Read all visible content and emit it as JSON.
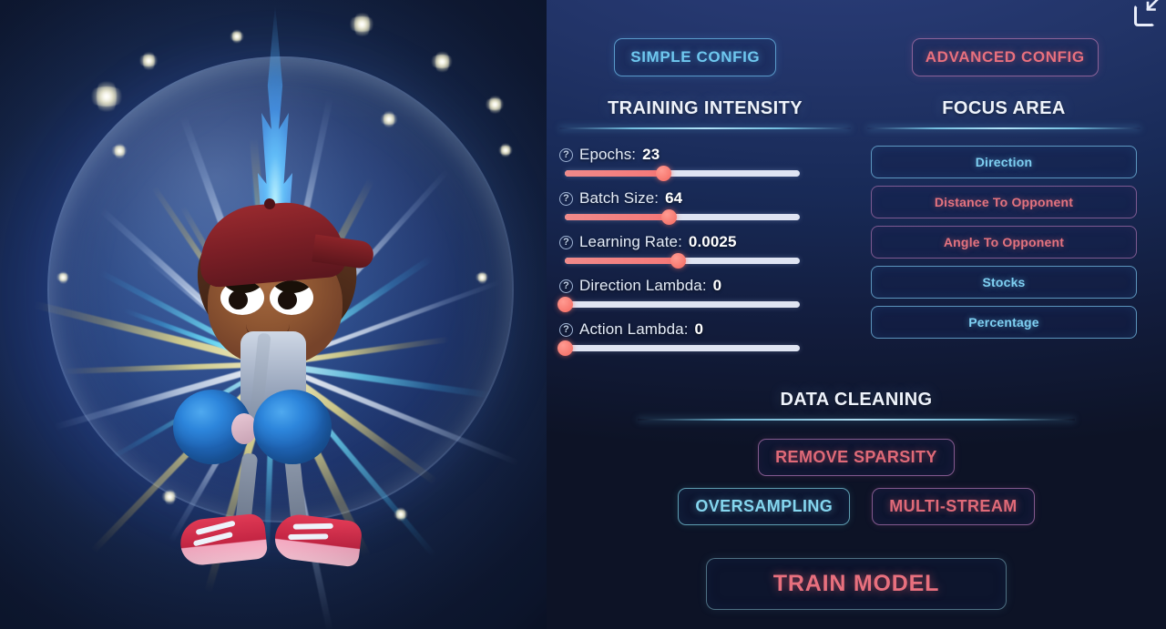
{
  "window": {
    "fullscreen_toggle_icon": "exit-fullscreen-icon"
  },
  "config_tabs": [
    {
      "label": "SIMPLE CONFIG",
      "variant": "cyan"
    },
    {
      "label": "ADVANCED CONFIG",
      "variant": "red"
    }
  ],
  "training_intensity": {
    "title": "TRAINING INTENSITY",
    "help_icon": "?",
    "sliders": [
      {
        "name": "Epochs",
        "label": "Epochs:",
        "value": "23",
        "percent": 42
      },
      {
        "name": "Batch Size",
        "label": "Batch Size:",
        "value": "64",
        "percent": 44
      },
      {
        "name": "Learning Rate",
        "label": "Learning Rate:",
        "value": "0.0025",
        "percent": 48
      },
      {
        "name": "Direction Lambda",
        "label": "Direction Lambda:",
        "value": "0",
        "percent": 0
      },
      {
        "name": "Action Lambda",
        "label": "Action Lambda:",
        "value": "0",
        "percent": 0
      }
    ]
  },
  "focus_area": {
    "title": "FOCUS AREA",
    "options": [
      {
        "label": "Direction",
        "state": "on",
        "variant": "cyan"
      },
      {
        "label": "Distance To Opponent",
        "state": "off",
        "variant": "red"
      },
      {
        "label": "Angle To Opponent",
        "state": "off",
        "variant": "red"
      },
      {
        "label": "Stocks",
        "state": "on",
        "variant": "cyan"
      },
      {
        "label": "Percentage",
        "state": "on",
        "variant": "cyan"
      }
    ]
  },
  "data_cleaning": {
    "title": "DATA CLEANING",
    "buttons": [
      {
        "label": "REMOVE SPARSITY",
        "variant": "red"
      },
      {
        "label": "OVERSAMPLING",
        "variant": "cyan"
      },
      {
        "label": "MULTI-STREAM",
        "variant": "red"
      }
    ]
  },
  "train": {
    "label": "TRAIN MODEL"
  },
  "character_art": {
    "description": "animated fighter with red backwards cap, blue boxing gloves, pink sneakers inside glowing energy shield"
  },
  "colors": {
    "accent_cyan": "#6fc8ef",
    "accent_red": "#e8707e",
    "slider_fill": "#f47878",
    "slider_track": "#dfe4f2",
    "background_top": "#1e2f66",
    "background_bottom": "#0c1122"
  }
}
